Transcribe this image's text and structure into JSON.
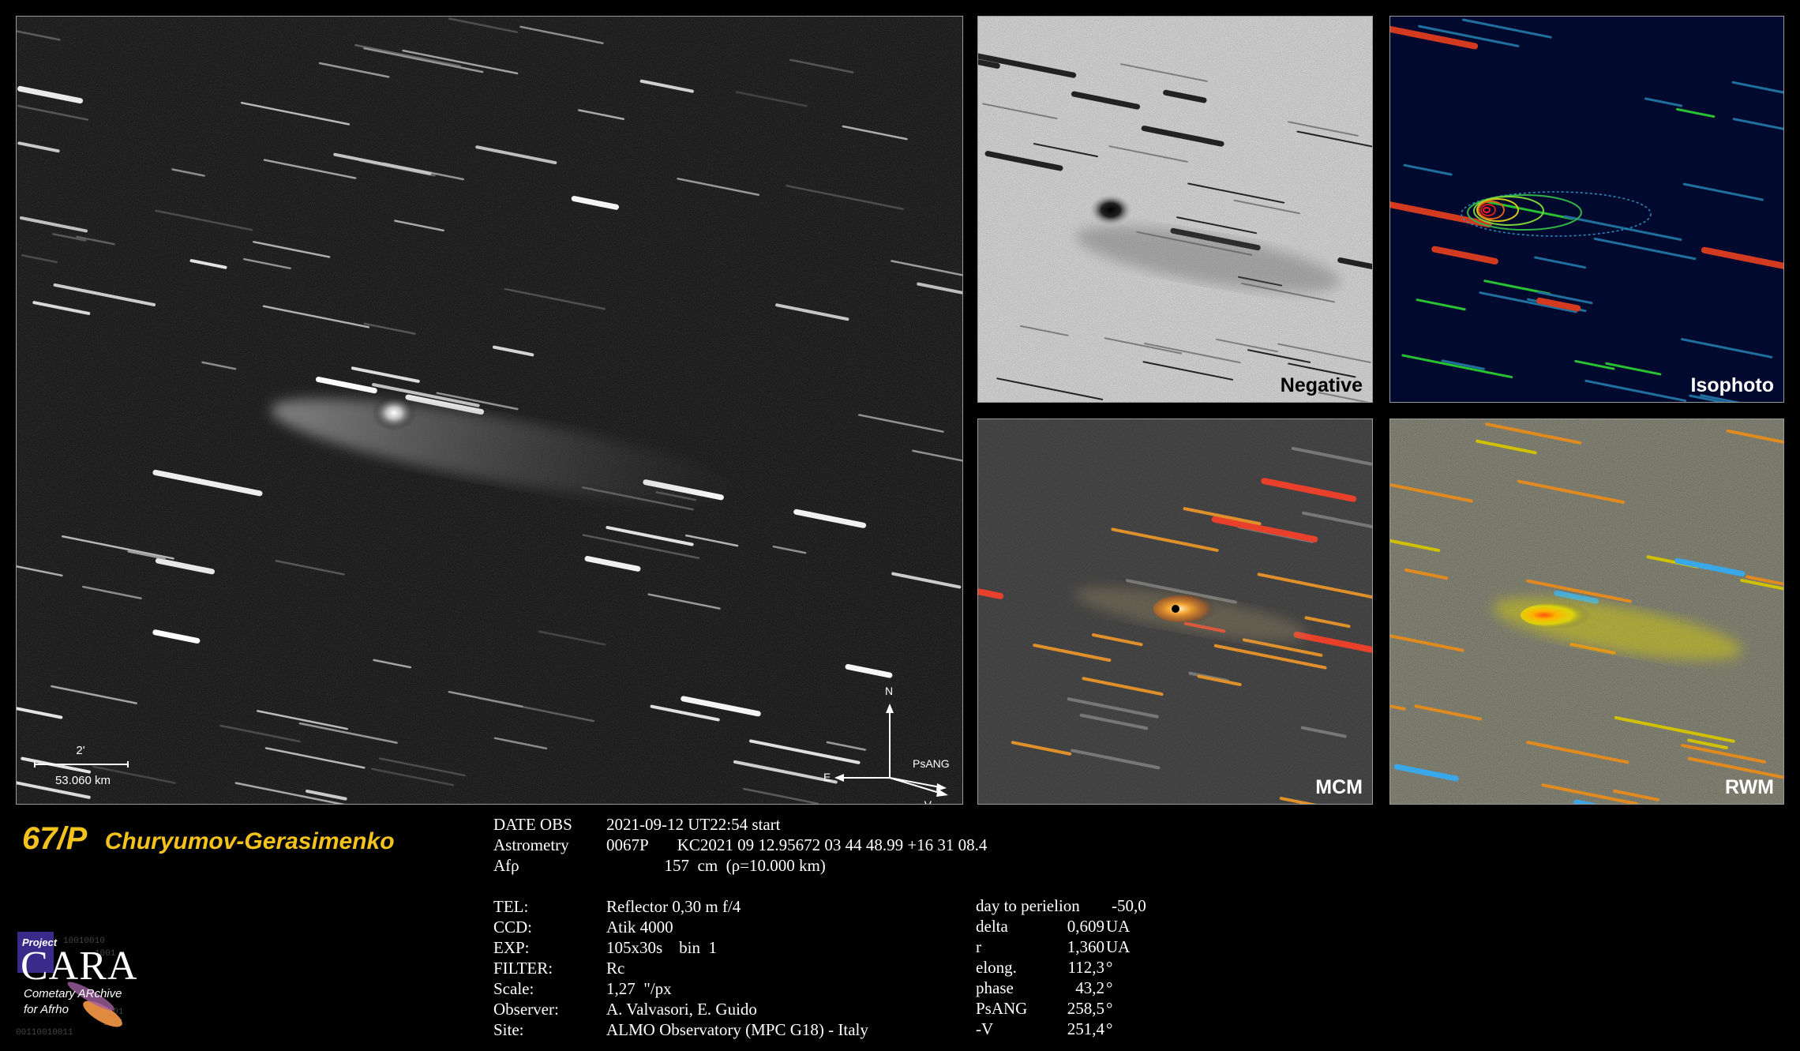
{
  "panels": {
    "negative_label": "Negative",
    "isophoto_label": "Isophoto",
    "mcm_label": "MCM",
    "rwm_label": "RWM"
  },
  "scale_bar": {
    "arcmin": "2'",
    "km": "53.060 km"
  },
  "compass": {
    "north": "N",
    "east": "E",
    "psang": "PsANG",
    "minus_v": "-V"
  },
  "title": {
    "designation": "67/P",
    "name": "Churyumov-Gerasimenko"
  },
  "observation": [
    {
      "key": "DATE OBS",
      "value": "2021-09-12 UT22:54 start"
    },
    {
      "key": "Astrometry",
      "value": "0067P       KC2021 09 12.95672 03 44 48.99 +16 31 08.4"
    },
    {
      "key": "Afρ",
      "value": "              157  cm  (ρ=10.000 km)"
    },
    {
      "key": "",
      "value": ""
    },
    {
      "key": "TEL:",
      "value": "Reflector 0,30 m f/4"
    },
    {
      "key": "CCD:",
      "value": "Atik 4000"
    },
    {
      "key": "EXP:",
      "value": "105x30s    bin  1"
    },
    {
      "key": "FILTER:",
      "value": "Rc"
    },
    {
      "key": "Scale:",
      "value": "1,27  \"/px"
    },
    {
      "key": "Observer:",
      "value": "A. Valvasori, E. Guido"
    },
    {
      "key": "Site:",
      "value": "ALMO Observatory (MPC G18) - Italy"
    }
  ],
  "ephemeris": [
    {
      "key": "day to perielion",
      "value": "-50,0",
      "unit": ""
    },
    {
      "key": "delta",
      "value": "0,609",
      "unit": "UA"
    },
    {
      "key": "r",
      "value": "1,360",
      "unit": "UA"
    },
    {
      "key": "elong.",
      "value": "112,3",
      "unit": "°"
    },
    {
      "key": "phase",
      "value": "43,2",
      "unit": "°"
    },
    {
      "key": "PsANG",
      "value": "258,5",
      "unit": "°"
    },
    {
      "key": "-V",
      "value": "251,4",
      "unit": "°"
    }
  ],
  "logo": {
    "project": "Project",
    "cara": "CARA",
    "line1": "Cometary ARchive",
    "line2": "for Afrho"
  },
  "colors": {
    "title": "#f3c21d",
    "iso_bg": "#010a2e",
    "border": "#9a9a9a"
  }
}
